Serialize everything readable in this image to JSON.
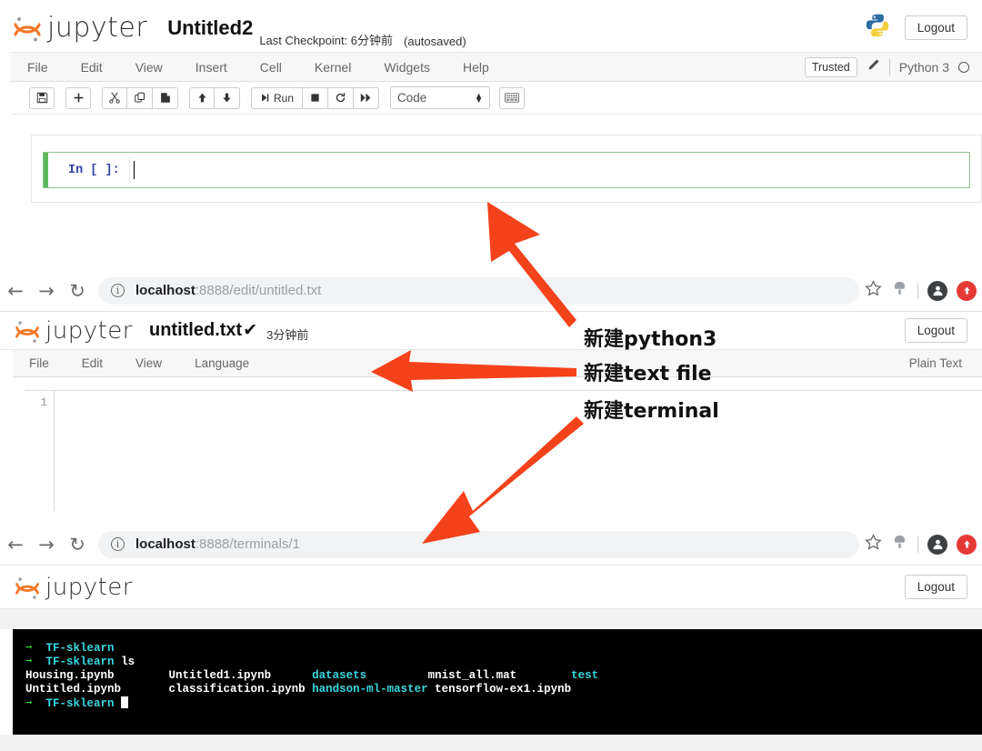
{
  "brand": {
    "wordmark": "jupyter",
    "logo_color": "#F37726"
  },
  "notebook": {
    "title": "Untitled2",
    "checkpoint": "Last Checkpoint: 6分钟前",
    "autosaved": "(autosaved)",
    "logout_label": "Logout",
    "menus": [
      "File",
      "Edit",
      "View",
      "Insert",
      "Cell",
      "Kernel",
      "Widgets",
      "Help"
    ],
    "trusted_label": "Trusted",
    "kernel_name": "Python 3",
    "toolbar": {
      "save_icon": "save-icon",
      "insert_icon": "plus-icon",
      "cut_icon": "scissors-icon",
      "copy_icon": "copy-icon",
      "paste_icon": "paste-icon",
      "up_icon": "arrow-up-icon",
      "down_icon": "arrow-down-icon",
      "run_label": "Run",
      "stop_icon": "stop-square-icon",
      "restart_icon": "restart-icon",
      "fastforward_icon": "fast-forward-icon",
      "cell_type": "Code",
      "keyboard_icon": "keyboard-icon"
    },
    "cell": {
      "prompt": "In [ ]:",
      "value": ""
    }
  },
  "editor": {
    "browser": {
      "back_icon": "back-arrow-icon",
      "forward_icon": "forward-arrow-icon",
      "reload_icon": "reload-icon",
      "info_icon": "info-circle-icon",
      "url_host": "localhost",
      "url_path": ":8888/edit/untitled.txt",
      "star_icon": "star-icon",
      "extension_icon": "extension-icon",
      "profile_icon": "profile-avatar-icon",
      "alert_icon": "red-badge-icon"
    },
    "title": "untitled.txt",
    "saved_check": "✔",
    "time": "3分钟前",
    "logout_label": "Logout",
    "menus": [
      "File",
      "Edit",
      "View",
      "Language"
    ],
    "mode_label": "Plain Text",
    "line_number": "1",
    "content": ""
  },
  "terminal": {
    "browser": {
      "back_icon": "back-arrow-icon",
      "forward_icon": "forward-arrow-icon",
      "reload_icon": "reload-icon",
      "info_icon": "info-circle-icon",
      "url_host": "localhost",
      "url_path": ":8888/terminals/1",
      "star_icon": "star-icon",
      "extension_icon": "extension-icon",
      "profile_icon": "profile-avatar-icon",
      "alert_icon": "red-badge-icon"
    },
    "logout_label": "Logout",
    "console": {
      "prompt_symbol": "➜",
      "prompt_dir": "TF-sklearn",
      "command": "ls",
      "lines": [
        {
          "type": "prompt",
          "dir": "TF-sklearn",
          "cmd": ""
        },
        {
          "type": "prompt",
          "dir": "TF-sklearn",
          "cmd": "ls"
        },
        {
          "type": "listing",
          "cols": [
            "Housing.ipynb",
            "Untitled1.ipynb",
            "datasets",
            "mnist_all.mat",
            "test"
          ]
        },
        {
          "type": "listing",
          "cols": [
            "Untitled.ipynb",
            "classification.ipynb",
            "handson-ml-master",
            "tensorflow-ex1.ipynb",
            ""
          ]
        },
        {
          "type": "prompt",
          "dir": "TF-sklearn",
          "cmd": ""
        }
      ],
      "files": [
        "Housing.ipynb",
        "Untitled.ipynb",
        "Untitled1.ipynb",
        "classification.ipynb",
        "mnist_all.mat",
        "tensorflow-ex1.ipynb"
      ],
      "dirs": [
        "datasets",
        "handson-ml-master",
        "test"
      ]
    }
  },
  "annotations": [
    {
      "text": "新建python3",
      "target": "notebook-cell"
    },
    {
      "text": "新建text file",
      "target": "editor-menubar"
    },
    {
      "text": "新建terminal",
      "target": "terminal-browser-bar"
    }
  ],
  "colors": {
    "arrow_red": "#F4421A",
    "jupyter_orange": "#F37726",
    "terminal_green": "#2fd32f",
    "terminal_cyan": "#36d7e0",
    "cell_green": "#5cb85c"
  }
}
